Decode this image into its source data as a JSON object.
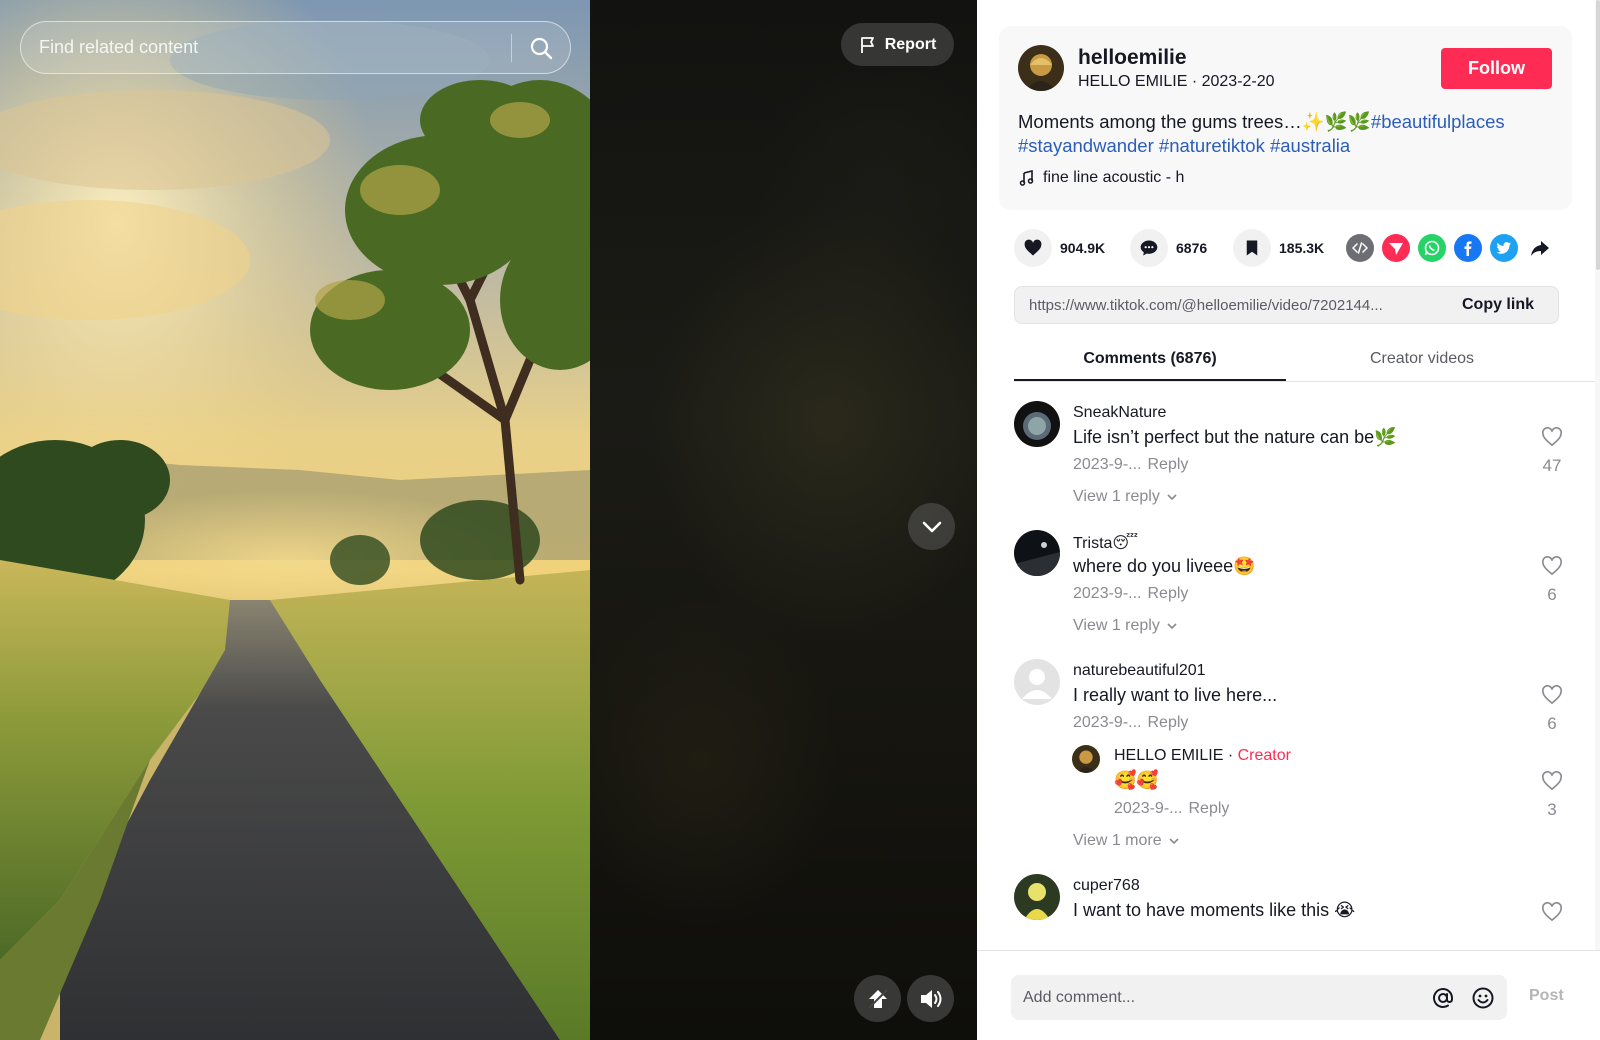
{
  "search": {
    "placeholder": "Find related content"
  },
  "video_controls": {
    "report_label": "Report"
  },
  "author": {
    "username": "helloemilie",
    "display_name": "HELLO EMILIE",
    "date": "2023-2-20",
    "follow_label": "Follow"
  },
  "post": {
    "description_text": "Moments among the gums trees…✨🌿🌿",
    "hashtags": [
      "#beautifulplaces",
      "#stayandwander",
      "#naturetiktok",
      "#australia"
    ],
    "music": "fine line acoustic - h"
  },
  "actions": {
    "likes": "904.9K",
    "comments": "6876",
    "saves": "185.3K"
  },
  "share_link": {
    "url": "https://www.tiktok.com/@helloemilie/video/7202144...",
    "copy_label": "Copy link"
  },
  "tabs": [
    {
      "label": "Comments (6876)",
      "active": true
    },
    {
      "label": "Creator videos",
      "active": false
    }
  ],
  "comments": [
    {
      "user": "SneakNature",
      "text": "Life isn’t perfect but the nature can be🌿",
      "date": "2023-9-...",
      "reply_label": "Reply",
      "likes": "47",
      "view_replies": "View 1 reply"
    },
    {
      "user": "Trista😴",
      "text": "where do you liveee🤩",
      "date": "2023-9-...",
      "reply_label": "Reply",
      "likes": "6",
      "view_replies": "View 1 reply"
    },
    {
      "user": "naturebeautiful201",
      "text": "I really want to live here...",
      "date": "2023-9-...",
      "reply_label": "Reply",
      "likes": "6",
      "reply": {
        "user": "HELLO EMILIE",
        "badge": "Creator",
        "text": "🥰🥰",
        "date": "2023-9-...",
        "reply_label": "Reply",
        "likes": "3"
      },
      "view_replies": "View 1 more"
    },
    {
      "user": "cuper768",
      "text": "I want to have moments like this 😭",
      "likes": ""
    }
  ],
  "comment_bar": {
    "placeholder": "Add comment...",
    "post_label": "Post"
  },
  "colors": {
    "accent": "#fe2c55",
    "hashtag": "#2b5db9",
    "muted": "#8a8b91"
  }
}
